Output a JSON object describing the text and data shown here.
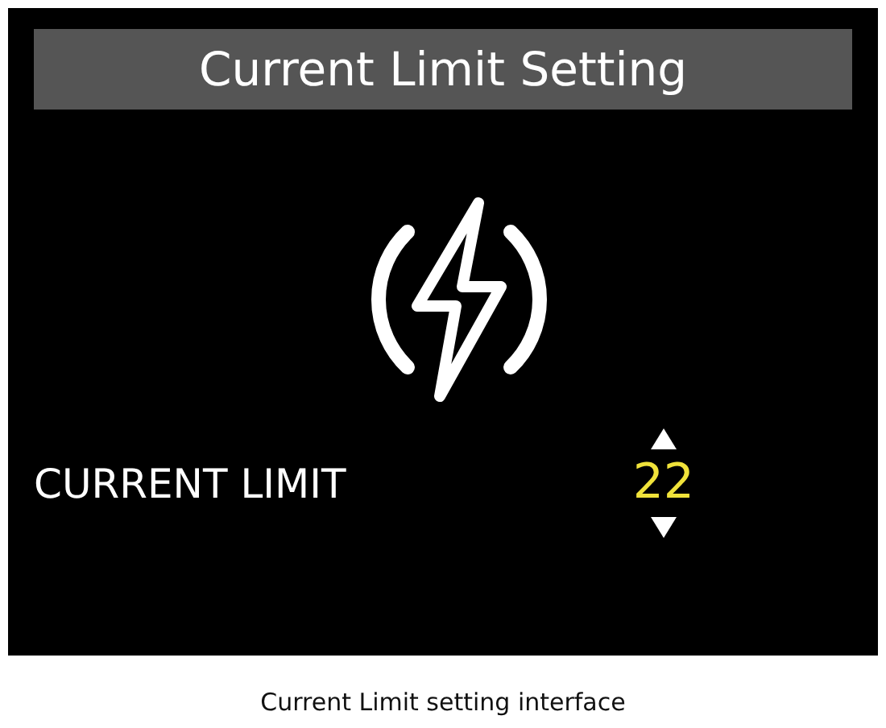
{
  "screen": {
    "title": "Current Limit Setting",
    "setting": {
      "label": "CURRENT LIMIT",
      "value": "22"
    }
  },
  "caption": "Current Limit setting interface"
}
